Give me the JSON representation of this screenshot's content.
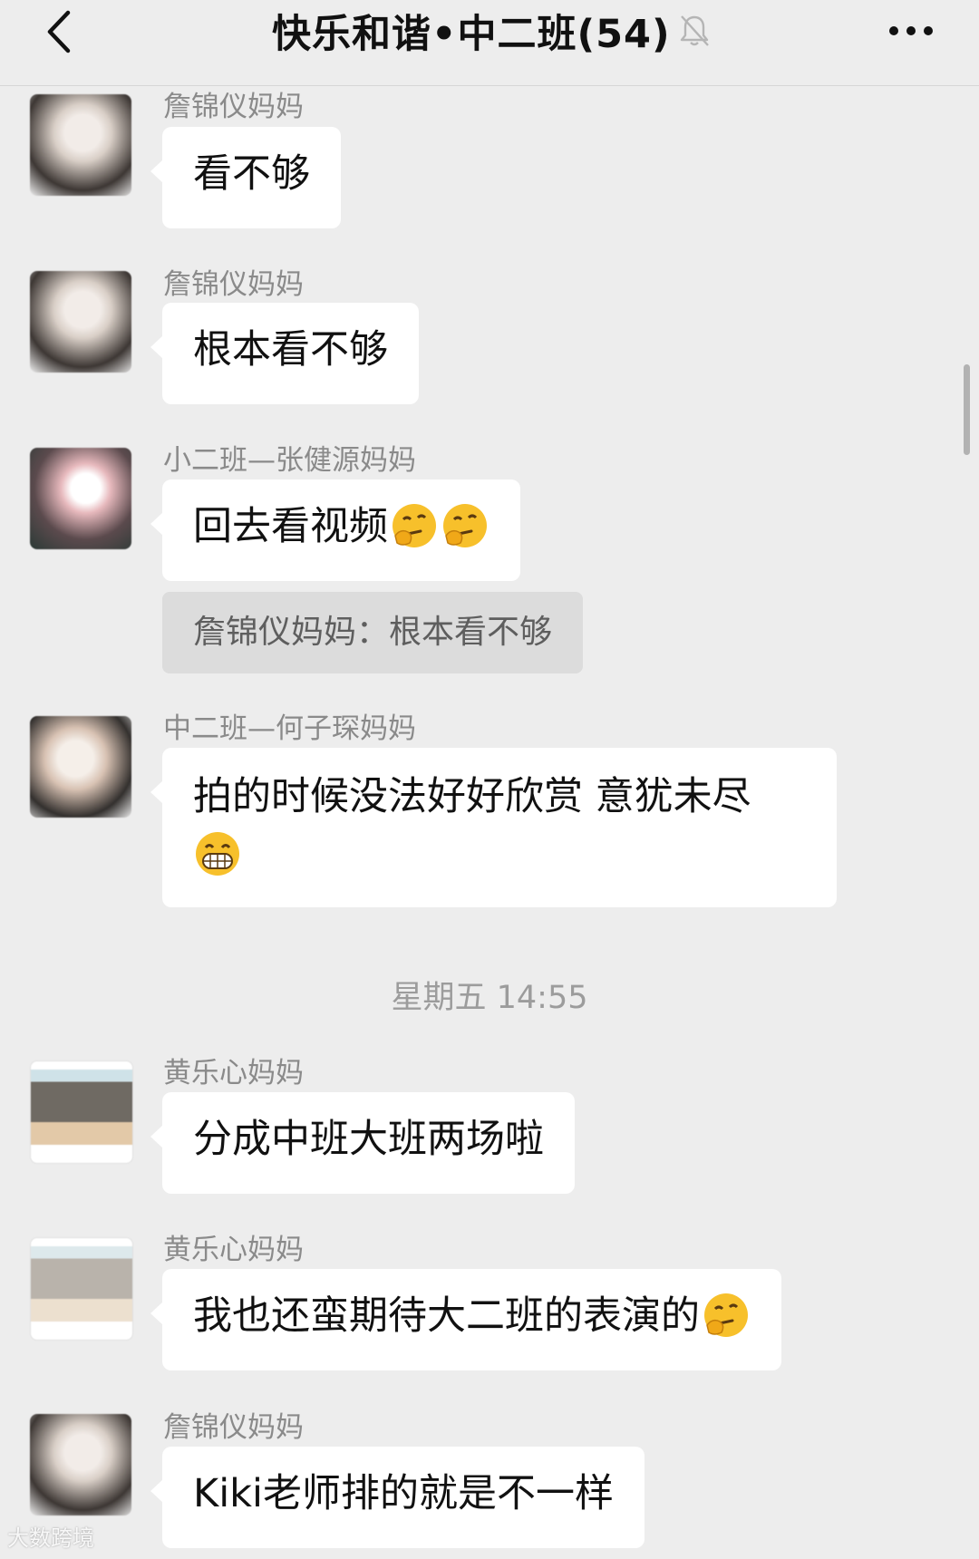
{
  "header": {
    "back_icon": "chevron-left-icon",
    "title": "快乐和谐•中二班(54)",
    "mute_icon": "bell-slash-icon",
    "more_icon": "ellipsis-icon"
  },
  "messages": [
    {
      "sender": "詹锦仪妈妈",
      "text": "看不够"
    },
    {
      "sender": "詹锦仪妈妈",
      "text": "根本看不够"
    },
    {
      "sender": "小二班—张健源妈妈",
      "text": "回去看视频",
      "emojis": [
        "thinking-face-icon",
        "thinking-face-icon"
      ],
      "quote": "詹锦仪妈妈：根本看不够"
    },
    {
      "sender": "中二班—何子琛妈妈",
      "text": "拍的时候没法好好欣赏 意犹未尽",
      "emojis": [
        "grinning-face-icon"
      ]
    },
    {
      "sender": "黄乐心妈妈",
      "text": "分成中班大班两场啦"
    },
    {
      "sender": "黄乐心妈妈",
      "text": "我也还蛮期待大二班的表演的",
      "emojis": [
        "thinking-face-icon"
      ]
    },
    {
      "sender": "詹锦仪妈妈",
      "text": "Kiki老师排的就是不一样"
    }
  ],
  "timestamp": "星期五 14:55",
  "watermark": "大数跨境",
  "colors": {
    "background": "#ededed",
    "bubble": "#ffffff",
    "quote": "#dcdcdc",
    "sender_text": "#8a8a8a",
    "emoji": "#f7c02b"
  }
}
